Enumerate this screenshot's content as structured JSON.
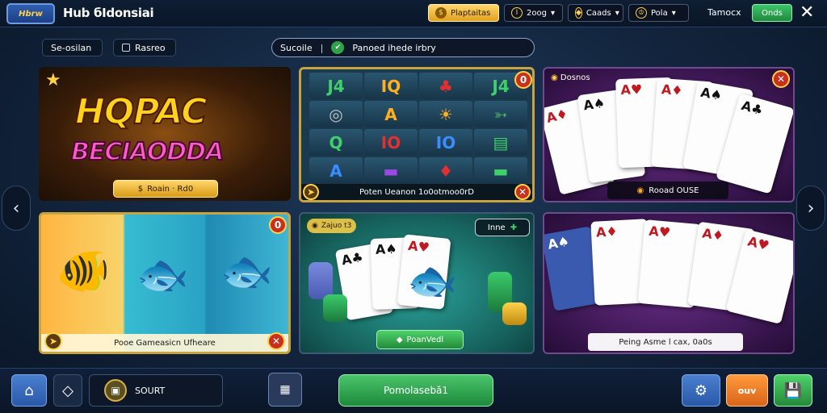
{
  "topbar": {
    "logo_text": "Hbrw",
    "title": "Hub бIdonsiai",
    "balance_label": "Plaptaitas",
    "stat1": "2oog",
    "stat2": "Caads",
    "stat3": "Pola",
    "timezone_label": "Tamocx",
    "timezone_button": "Onds",
    "close": "✕"
  },
  "filters": {
    "chip1": "Se-osilan",
    "chip2": "Rasreo"
  },
  "search": {
    "left": "Sucoile",
    "right": "Panoed ihede irbry"
  },
  "cards": {
    "hero": {
      "line1": "HQPAC",
      "line2": "BECIAODDA",
      "button": "Roain · Rd0"
    },
    "slots": {
      "footer": "Poten Ueanon 1o0otmoo0rD",
      "symbols": [
        "J4",
        "IQ",
        "♣",
        "J4",
        "◎",
        "A",
        "☀",
        "➳",
        "Q",
        "IO",
        "IO",
        "▤",
        "A",
        "▬",
        "♦",
        "▬"
      ]
    },
    "cards_game": {
      "label": "Dosnos",
      "footer": "Rooad OUSE"
    },
    "fish": {
      "footer": "Pooe Gameasicn Ufheare"
    },
    "poker": {
      "tag": "Zajuo t3",
      "tag2": "Inne",
      "button": "PoanVedl"
    },
    "rummy": {
      "footer": "Peing Asme l cax, 0a0s"
    }
  },
  "bottom": {
    "wallet_label": "SOURT",
    "main_button": "Pomolasebӑ1",
    "orange_button": "ouv"
  },
  "icons": {
    "left_arrow": "‹",
    "right_arrow": "›",
    "home": "⌂",
    "gear": "⚙"
  }
}
